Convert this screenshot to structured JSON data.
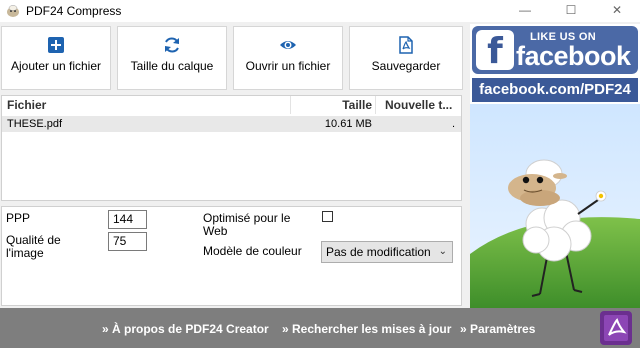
{
  "window": {
    "title": "PDF24 Compress",
    "controls": {
      "minimize": "—",
      "maximize": "☐",
      "close": "✕"
    }
  },
  "toolbar": {
    "buttons": [
      {
        "label": "Ajouter un fichier",
        "icon": "plus-icon"
      },
      {
        "label": "Taille du calque",
        "icon": "refresh-icon"
      },
      {
        "label": "Ouvrir un fichier",
        "icon": "eye-icon"
      },
      {
        "label": "Sauvegarder",
        "icon": "pdf-save-icon"
      }
    ],
    "icon_color": "#1e63b0"
  },
  "file_list": {
    "columns": [
      "Fichier",
      "Taille",
      "Nouvelle t..."
    ],
    "rows": [
      {
        "file": "THESE.pdf",
        "size": "10.61 MB",
        "new_size": "."
      }
    ]
  },
  "settings": {
    "ppp_label": "PPP",
    "ppp_value": "144",
    "quality_label_1": "Qualité de",
    "quality_label_2": "l'image",
    "quality_value": "75",
    "web_label_1": "Optimisé pour le",
    "web_label_2": "Web",
    "web_checked": false,
    "color_model_label": "Modèle de couleur",
    "color_model_value": "Pas de modification"
  },
  "ad": {
    "like_text": "LIKE US ON",
    "brand": "facebook",
    "f_letter": "f",
    "url": "facebook.com/PDF24",
    "brand_color": "#3b5998"
  },
  "footer": {
    "links": [
      "» À propos de PDF24 Creator",
      "» Rechercher les mises à jour",
      "» Paramètres"
    ],
    "background": "#7e7e7e"
  }
}
